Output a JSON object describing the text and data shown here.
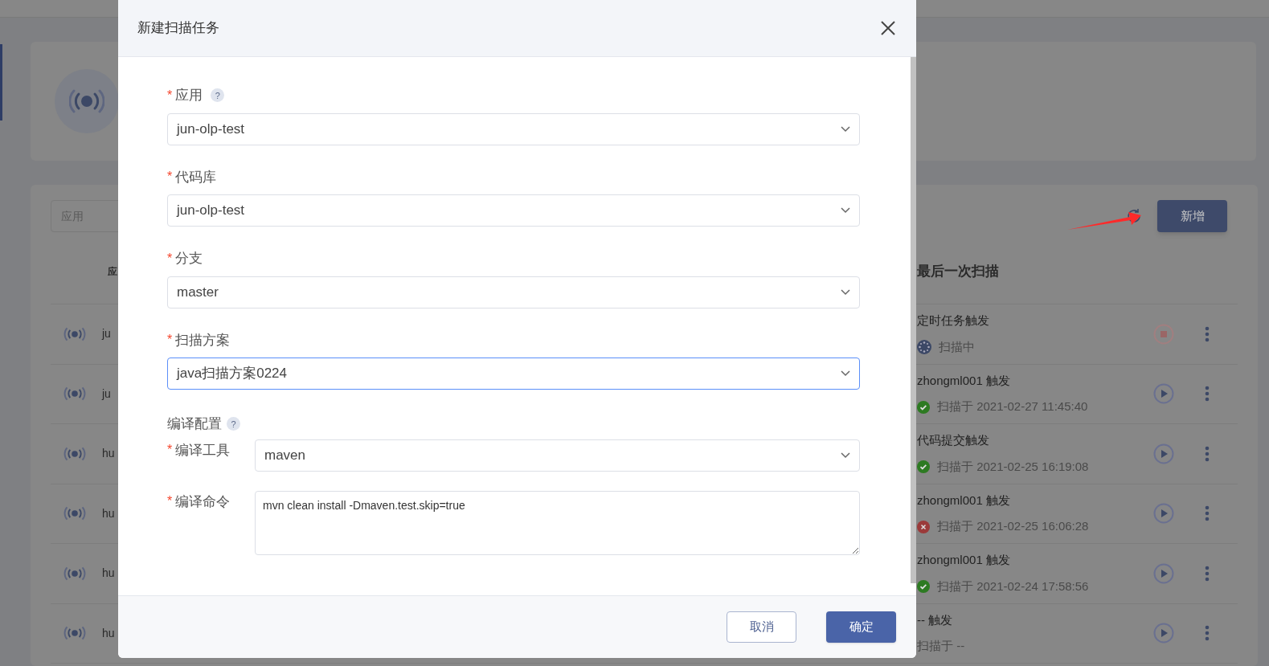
{
  "page": {
    "search": {
      "placeholder": "应用"
    },
    "new_button": "新增",
    "table": {
      "columns": [
        "应",
        "最后一次扫描"
      ],
      "rows": [
        {
          "app": "ju",
          "trigger": "定时任务触发",
          "status": {
            "kind": "scanning",
            "text": "扫描中"
          },
          "action": {
            "kind": "stop"
          }
        },
        {
          "app": "ju",
          "trigger": "zhongml001 触发",
          "status": {
            "kind": "success",
            "text": "扫描于 2021-02-27 11:45:40"
          },
          "action": {
            "kind": "run"
          }
        },
        {
          "app": "hu",
          "trigger": "代码提交触发",
          "status": {
            "kind": "success",
            "text": "扫描于 2021-02-25 16:19:08"
          },
          "action": {
            "kind": "run"
          }
        },
        {
          "app": "hu",
          "trigger": "zhongml001 触发",
          "status": {
            "kind": "failed",
            "text": "扫描于 2021-02-25 16:06:28"
          },
          "action": {
            "kind": "run"
          }
        },
        {
          "app": "hu",
          "trigger": "zhongml001 触发",
          "status": {
            "kind": "success",
            "text": "扫描于 2021-02-24 17:58:56"
          },
          "action": {
            "kind": "run"
          }
        },
        {
          "app": "hu",
          "trigger": "-- 触发",
          "status": {
            "kind": "none",
            "text": "扫描于 --"
          },
          "action": {
            "kind": "run"
          }
        }
      ]
    }
  },
  "dialog": {
    "title": "新建扫描任务",
    "fields": [
      {
        "label": "应用",
        "required_mark": "*",
        "help": "?",
        "value": "jun-olp-test",
        "focused": false
      },
      {
        "label": "代码库",
        "required_mark": "*",
        "value": "jun-olp-test",
        "focused": false
      },
      {
        "label": "分支",
        "required_mark": "*",
        "value": "master",
        "focused": false
      },
      {
        "label": "扫描方案",
        "required_mark": "*",
        "value": "java扫描方案0224",
        "focused": true
      }
    ],
    "compile_config": {
      "title": "编译配置",
      "help": "?",
      "fields": [
        {
          "kind": "select",
          "label": "编译工具",
          "required_mark": "*",
          "value": "maven"
        },
        {
          "kind": "textarea",
          "label": "编译命令",
          "required_mark": "*",
          "value": "mvn clean install -Dmaven.test.skip=true"
        }
      ]
    },
    "buttons": [
      {
        "label": "取消",
        "primary": false
      },
      {
        "label": "确定",
        "primary": true
      }
    ]
  }
}
